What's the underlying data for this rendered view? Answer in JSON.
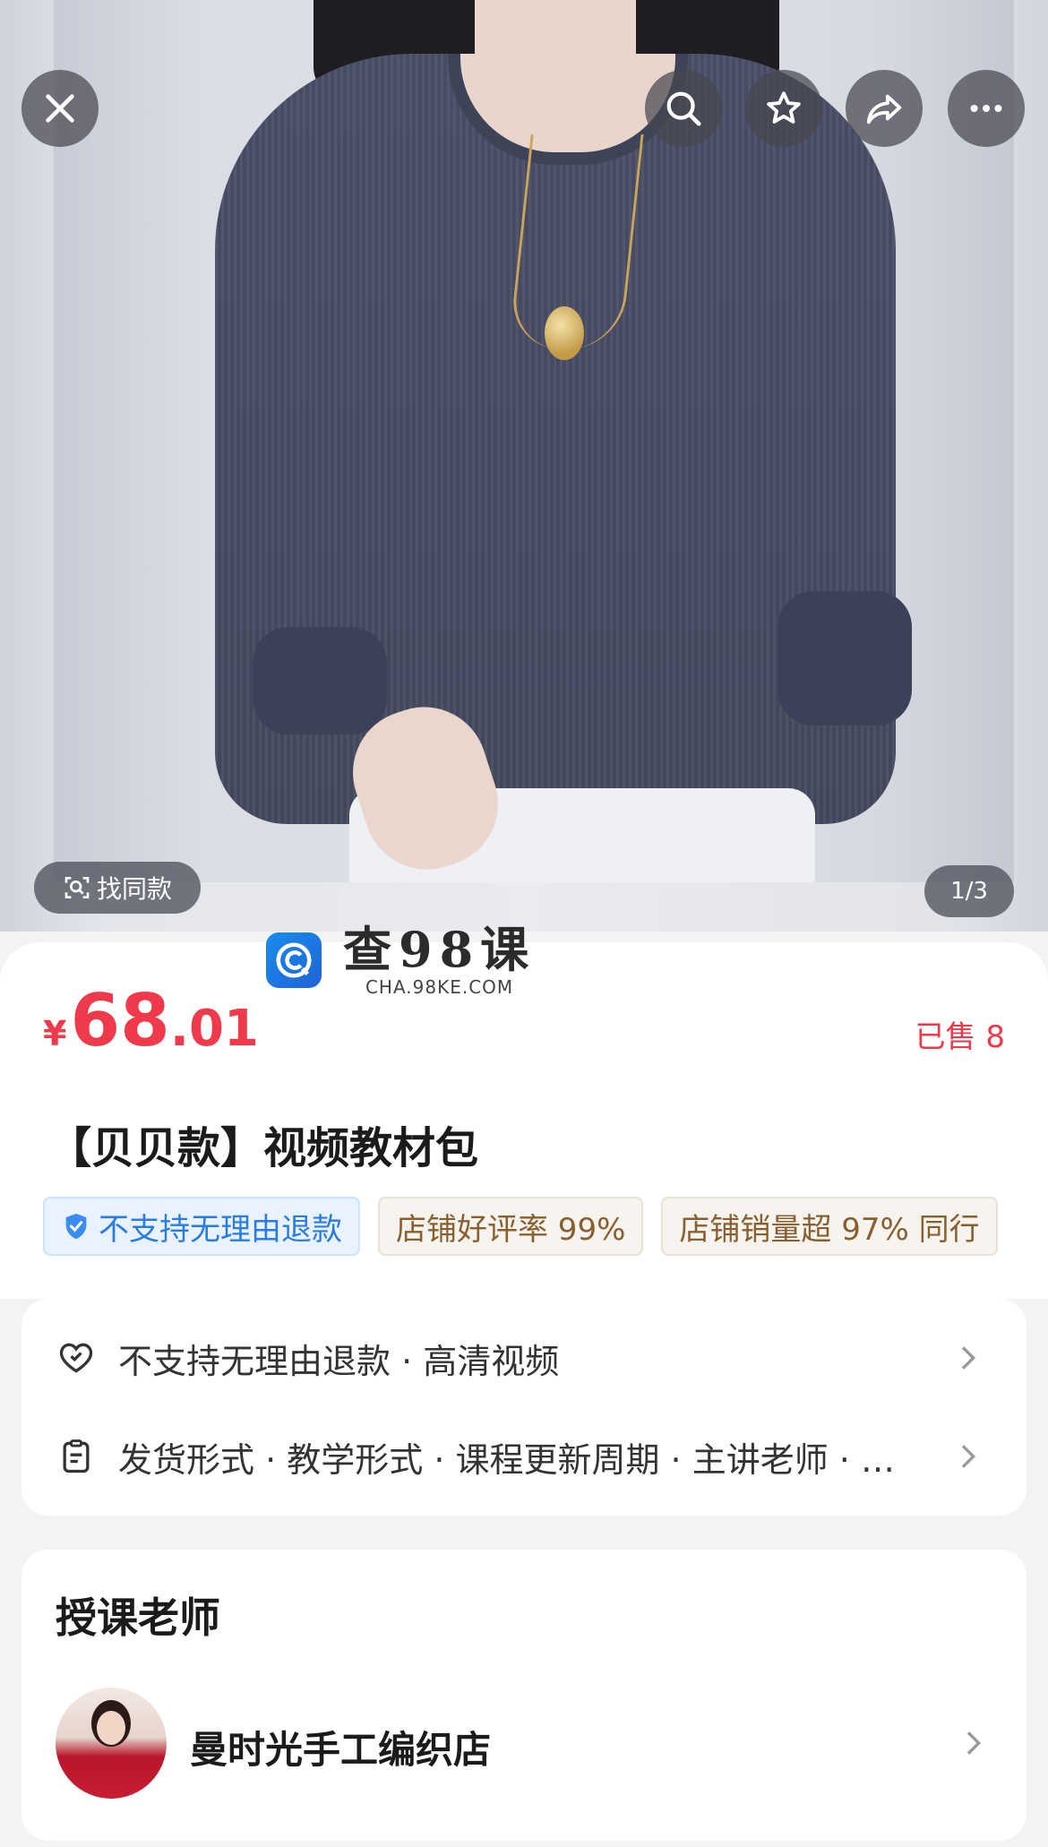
{
  "top_bar": {
    "close_icon": "close-icon",
    "search_icon": "search-icon",
    "favorite_icon": "star-icon",
    "share_icon": "share-icon",
    "more_icon": "more-icon"
  },
  "gallery": {
    "find_same_label": "找同款",
    "counter": "1/3"
  },
  "watermark": {
    "cn": "查98课",
    "en": "CHA.98KE.COM"
  },
  "product": {
    "currency": "¥",
    "price_int": "68",
    "price_dec": ".01",
    "sold": "已售 8",
    "title": "【贝贝款】视频教材包",
    "tags": [
      "不支持无理由退款",
      "店铺好评率 99%",
      "店铺销量超 97% 同行"
    ]
  },
  "info": {
    "row1": "不支持无理由退款 · 高清视频",
    "row2": "发货形式 · 教学形式 · 课程更新周期 · 主讲老师 · …"
  },
  "teacher": {
    "heading": "授课老师",
    "shop_name": "曼时光手工编织店"
  },
  "colors": {
    "price_red": "#ef3a4b",
    "tag_blue": "#2c7be0",
    "tag_brown": "#8a5f30"
  }
}
